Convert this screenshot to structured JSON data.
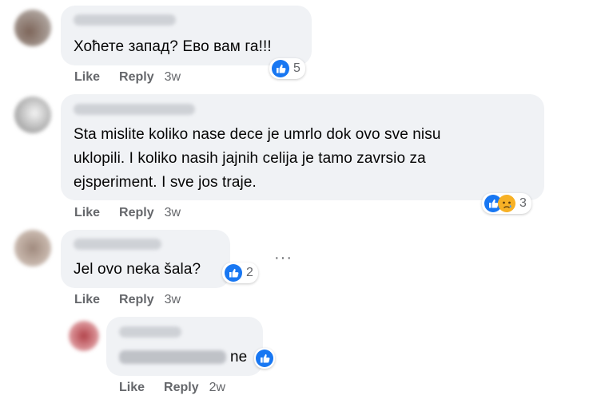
{
  "comments": [
    {
      "text": "Хоћете запад? Ево вам га!!!",
      "reaction_count": "5",
      "like_label": "Like",
      "reply_label": "Reply",
      "time": "3w"
    },
    {
      "text_lines": [
        "Sta mislite koliko nase dece je umrlo dok ovo sve nisu",
        "uklopili. I koliko nasih jajnih celija je tamo zavrsio za",
        "ejsperiment. I sve jos traje."
      ],
      "reaction_count": "3",
      "like_label": "Like",
      "reply_label": "Reply",
      "time": "3w"
    },
    {
      "text": "Jel ovo neka šala?",
      "reaction_count": "2",
      "like_label": "Like",
      "reply_label": "Reply",
      "time": "3w",
      "more_label": "···"
    },
    {
      "text": "ne",
      "like_label": "Like",
      "reply_label": "Reply",
      "time": "2w"
    }
  ],
  "colors": {
    "bubble": "#f0f2f5",
    "meta_text": "#65676b",
    "like_blue": "#1877f2",
    "sad_yellow": "#f7b125"
  },
  "icons": [
    "like-reaction-icon",
    "sad-reaction-icon",
    "more-options-icon"
  ]
}
